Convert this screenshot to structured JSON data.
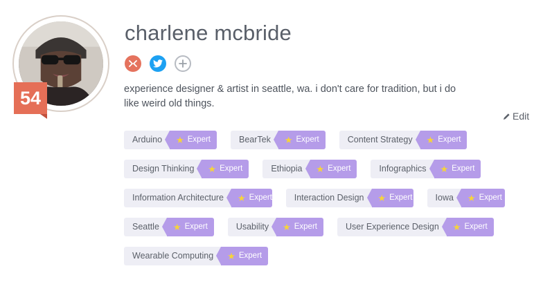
{
  "profile": {
    "name": "charlene mcbride",
    "score": "54",
    "bio": "experience designer & artist in seattle, wa. i don't care for tradition, but i do like weird old things.",
    "edit_label": "Edit"
  },
  "socials": [
    {
      "icon": "dribbble-icon",
      "color": "#e5735e"
    },
    {
      "icon": "twitter-icon",
      "color": "#1da1f2"
    },
    {
      "icon": "add-icon",
      "color": "#b7bbc2"
    }
  ],
  "colors": {
    "tag_bg": "#eeeef5",
    "level_bg": "#b59ce9",
    "star": "#f6d43a",
    "score_badge": "#e56f57"
  },
  "tag_rows": [
    [
      {
        "name": "Arduino",
        "level": "Expert"
      },
      {
        "name": "BearTek",
        "level": "Expert"
      },
      {
        "name": "Content Strategy",
        "level": "Expert"
      }
    ],
    [
      {
        "name": "Design Thinking",
        "level": "Expert"
      },
      {
        "name": "Ethiopia",
        "level": "Expert"
      },
      {
        "name": "Infographics",
        "level": "Expert"
      }
    ],
    [
      {
        "name": "Information Architecture",
        "level": "Expert"
      },
      {
        "name": "Interaction Design",
        "level": "Expert"
      },
      {
        "name": "Iowa",
        "level": "Expert"
      }
    ],
    [
      {
        "name": "Seattle",
        "level": "Expert"
      },
      {
        "name": "Usability",
        "level": "Expert"
      },
      {
        "name": "User Experience Design",
        "level": "Expert"
      }
    ],
    [
      {
        "name": "Wearable Computing",
        "level": "Expert"
      }
    ]
  ]
}
